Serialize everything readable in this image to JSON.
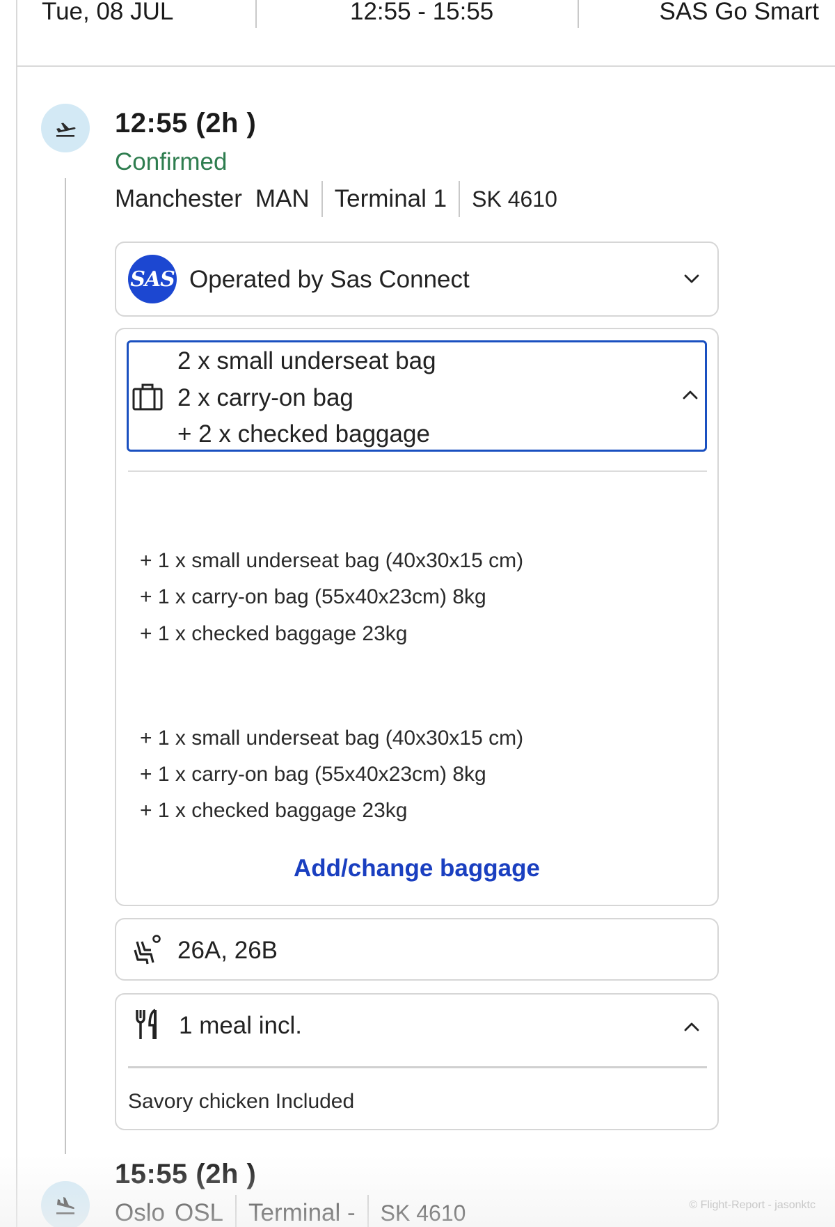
{
  "header": {
    "date": "Tue, 08 JUL",
    "time_range": "12:55 - 15:55",
    "fare": "SAS Go Smart"
  },
  "departure": {
    "time_title": "12:55  (2h )",
    "status": "Confirmed",
    "city": "Manchester",
    "airport_code": "MAN",
    "terminal": "Terminal  1",
    "flight": "SK 4610",
    "status_color": "#2e7d4f"
  },
  "operator": {
    "logo_text": "SAS",
    "label": "Operated by Sas Connect"
  },
  "baggage": {
    "summary": [
      "2 x small underseat bag",
      "2 x carry-on bag",
      "+ 2 x checked baggage"
    ],
    "passenger_1": [
      "+ 1 x small underseat bag (40x30x15 cm)",
      "+ 1 x carry-on bag (55x40x23cm) 8kg",
      "+ 1 x checked baggage 23kg"
    ],
    "passenger_2": [
      "+ 1 x small underseat bag (40x30x15 cm)",
      "+ 1 x carry-on bag (55x40x23cm) 8kg",
      "+ 1 x checked baggage 23kg"
    ],
    "add_link": "Add/change baggage",
    "link_color": "#1a3fc0"
  },
  "seats": {
    "value": "26A, 26B"
  },
  "meal": {
    "label": "1 meal incl.",
    "detail": "Savory chicken Included"
  },
  "arrival": {
    "time_title": "15:55  (2h )",
    "city": "Oslo",
    "airport_code": "OSL",
    "terminal": "Terminal  -",
    "flight": "SK 4610"
  },
  "watermark": "© Flight-Report - jasonktc",
  "icons": {
    "departure": "plane-takeoff-icon",
    "arrival": "plane-landing-icon",
    "baggage": "briefcase-icon",
    "seat": "seat-icon",
    "meal": "fork-knife-icon",
    "expand": "chevron-down-icon",
    "collapse": "chevron-up-icon"
  }
}
